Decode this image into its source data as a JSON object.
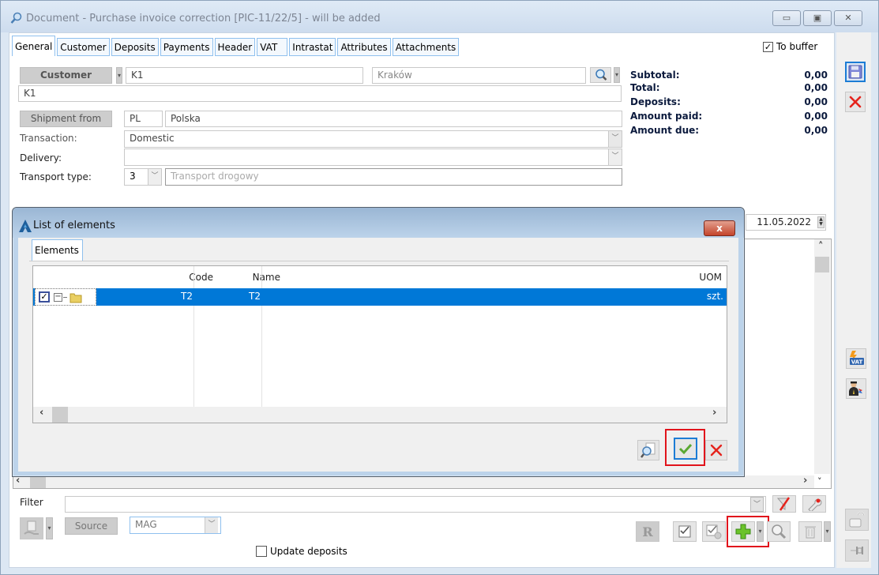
{
  "window": {
    "title": "Document - Purchase invoice correction [PIC-11/22/5]  - will be added",
    "title_icon": "search-icon",
    "controls": {
      "minimize": "▭",
      "maximize": "▣",
      "close": "✕"
    }
  },
  "tabs": [
    {
      "label": "General",
      "active": true
    },
    {
      "label": "Customer"
    },
    {
      "label": "Deposits"
    },
    {
      "label": "Payments"
    },
    {
      "label": "Header"
    },
    {
      "label": "VAT"
    },
    {
      "label": "Intrastat"
    },
    {
      "label": "Attributes"
    },
    {
      "label": "Attachments"
    }
  ],
  "to_buffer": {
    "label": "To buffer",
    "checked": true
  },
  "customer": {
    "button_label": "Customer",
    "dropdown_glyph": "▾",
    "code": "K1",
    "city": "Kraków",
    "name": "K1"
  },
  "shipment": {
    "button_label": "Shipment from",
    "country_code": "PL",
    "country_name": "Polska"
  },
  "transaction": {
    "label": "Transaction:",
    "value": "Domestic"
  },
  "delivery": {
    "label": "Delivery:",
    "value": ""
  },
  "transport": {
    "label": "Transport type:",
    "code": "3",
    "placeholder": "Transport drogowy"
  },
  "summary": [
    {
      "label": "Subtotal:",
      "value": "0,00"
    },
    {
      "label": "Total:",
      "value": "0,00"
    },
    {
      "label": "Deposits:",
      "value": "0,00"
    },
    {
      "label": "Amount paid:",
      "value": "0,00"
    },
    {
      "label": "Amount due:",
      "value": "0,00"
    }
  ],
  "date": "11.05.2022",
  "dialog": {
    "title": "List of elements",
    "close_label": "x",
    "tab": "Elements",
    "columns": [
      "Code",
      "Name",
      "UOM"
    ],
    "rows": [
      {
        "checked": true,
        "code": "T2",
        "name": "T2",
        "uom": "szt.",
        "selected": true
      }
    ]
  },
  "filter": {
    "label": "Filter",
    "value": ""
  },
  "source": {
    "button_label": "Source",
    "value": "MAG"
  },
  "update_deposits": {
    "label": "Update deposits",
    "checked": false
  },
  "colors": {
    "selection": "#0078d7",
    "highlight": "#e1141c",
    "title_text": "#7d8593",
    "summary_text": "#0b1a3d"
  }
}
